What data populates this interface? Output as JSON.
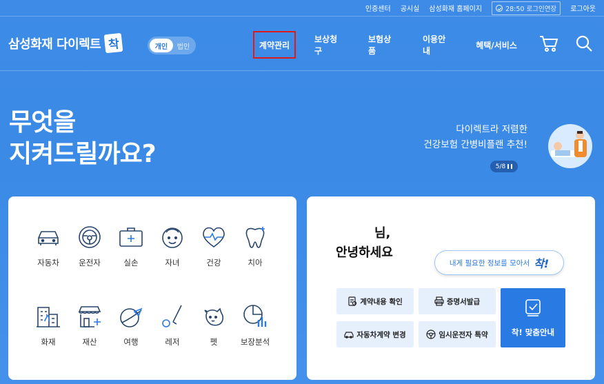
{
  "util": {
    "links": [
      "인증센터",
      "공시실",
      "삼성화재 홈페이지"
    ],
    "timer": "28:50 로그인연장",
    "logout": "로그아웃"
  },
  "header": {
    "logo_text": "삼성화재 다이렉트",
    "logo_badge": "착",
    "toggle_on": "개인",
    "toggle_off": "법인",
    "nav": [
      "계약관리",
      "보상청구",
      "보험상품",
      "이용안내",
      "혜택/서비스"
    ],
    "cart_icon": "cart-icon",
    "search_icon": "search-icon",
    "highlight_color": "#e01a1a"
  },
  "hero": {
    "title_line1": "무엇을",
    "title_line2": "지켜드릴까요?",
    "promo_line1": "다이렉트라 저렴한",
    "promo_line2": "건강보험 간병비플랜 추천!",
    "pager": "5/8"
  },
  "categories": [
    {
      "label": "자동차",
      "icon": "car-icon"
    },
    {
      "label": "운전자",
      "icon": "steering-wheel-icon"
    },
    {
      "label": "실손",
      "icon": "medical-kit-icon"
    },
    {
      "label": "자녀",
      "icon": "child-face-icon"
    },
    {
      "label": "건강",
      "icon": "heart-pulse-icon"
    },
    {
      "label": "치아",
      "icon": "tooth-icon"
    },
    {
      "label": "화재",
      "icon": "building-fire-icon"
    },
    {
      "label": "재산",
      "icon": "store-icon"
    },
    {
      "label": "여행",
      "icon": "plane-globe-icon"
    },
    {
      "label": "레저",
      "icon": "golf-icon"
    },
    {
      "label": "펫",
      "icon": "pet-icon"
    },
    {
      "label": "보장분석",
      "icon": "analysis-chart-icon"
    }
  ],
  "greeting": {
    "line1": "님,",
    "line2": "안녕하세요",
    "bubble_text": "내게 필요한 정보를 모아서",
    "bubble_badge": "착!"
  },
  "quick": {
    "contract": "계약내용 확인",
    "certificate": "증명서발급",
    "car_change": "자동차계약 변경",
    "temp_driver": "임시운전자 특약",
    "custom_guide": "착! 맞춤안내"
  }
}
